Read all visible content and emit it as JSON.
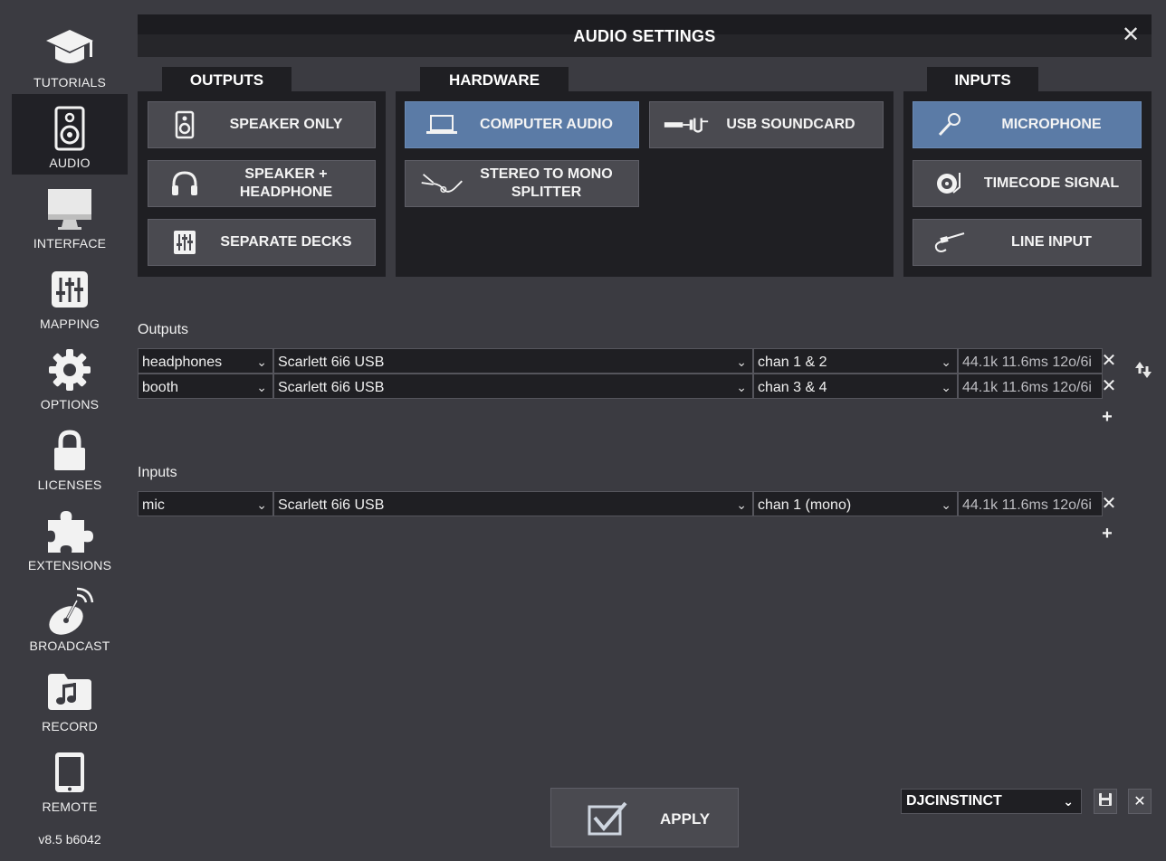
{
  "window": {
    "title": "AUDIO SETTINGS",
    "close_glyph": "✕"
  },
  "sidebar": {
    "items": [
      {
        "label": "TUTORIALS",
        "icon": "graduation-cap-icon",
        "active": false
      },
      {
        "label": "AUDIO",
        "icon": "speaker-icon",
        "active": true
      },
      {
        "label": "INTERFACE",
        "icon": "monitor-icon",
        "active": false
      },
      {
        "label": "MAPPING",
        "icon": "mixer-sliders-icon",
        "active": false
      },
      {
        "label": "OPTIONS",
        "icon": "gear-icon",
        "active": false
      },
      {
        "label": "LICENSES",
        "icon": "lock-icon",
        "active": false
      },
      {
        "label": "EXTENSIONS",
        "icon": "puzzle-icon",
        "active": false
      },
      {
        "label": "BROADCAST",
        "icon": "satellite-dish-icon",
        "active": false
      },
      {
        "label": "RECORD",
        "icon": "music-folder-icon",
        "active": false
      },
      {
        "label": "REMOTE",
        "icon": "tablet-icon",
        "active": false
      }
    ],
    "version": "v8.5 b6042"
  },
  "tabs": {
    "outputs": "OUTPUTS",
    "hardware": "HARDWARE",
    "inputs": "INPUTS"
  },
  "outputs_buttons": [
    {
      "label": "SPEAKER ONLY",
      "icon": "speaker-icon"
    },
    {
      "label": "SPEAKER + HEADPHONE",
      "icon": "headphones-icon"
    },
    {
      "label": "SEPARATE DECKS",
      "icon": "mixer-icon"
    }
  ],
  "hardware_buttons": [
    {
      "label": "COMPUTER AUDIO",
      "icon": "laptop-icon",
      "selected": true
    },
    {
      "label": "USB SOUNDCARD",
      "icon": "usb-cable-icon",
      "selected": false
    },
    {
      "label": "STEREO TO MONO SPLITTER",
      "icon": "splitter-cable-icon",
      "selected": false
    }
  ],
  "inputs_buttons": [
    {
      "label": "MICROPHONE",
      "icon": "microphone-icon",
      "selected": true
    },
    {
      "label": "TIMECODE SIGNAL",
      "icon": "turntable-icon",
      "selected": false
    },
    {
      "label": "LINE INPUT",
      "icon": "rca-cable-icon",
      "selected": false
    }
  ],
  "outputs_section": {
    "label": "Outputs",
    "rows": [
      {
        "role": "headphones",
        "device": "Scarlett 6i6 USB",
        "channel": "chan 1 & 2",
        "info": "44.1k 11.6ms 12o/6i"
      },
      {
        "role": "booth",
        "device": "Scarlett 6i6 USB",
        "channel": "chan 3 & 4",
        "info": "44.1k 11.6ms 12o/6i"
      }
    ]
  },
  "inputs_section": {
    "label": "Inputs",
    "rows": [
      {
        "role": "mic",
        "device": "Scarlett 6i6 USB",
        "channel": "chan 1 (mono)",
        "info": "44.1k 11.6ms 12o/6i"
      }
    ]
  },
  "glyphs": {
    "chevron": "⌄",
    "remove": "✕",
    "add": "+"
  },
  "footer": {
    "apply_label": "APPLY",
    "preset_value": "DJCINSTINCT"
  },
  "colors": {
    "selected_button": "#5b7ba6",
    "background": "#3b3b41",
    "panel": "#1f1f23"
  }
}
